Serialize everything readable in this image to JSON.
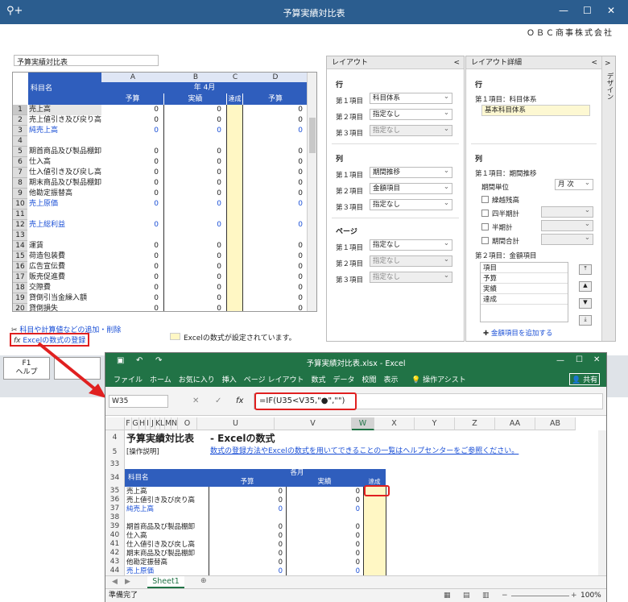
{
  "window": {
    "title": "予算実績対比表",
    "company": "ＯＢＣ商事株式会社",
    "minimize": "—",
    "maximize": "☐",
    "close": "✕"
  },
  "report_name": "予算実績対比表",
  "grid": {
    "col_letters": [
      "A",
      "B",
      "C",
      "D"
    ],
    "period": "年 4月",
    "item_header": "科目名",
    "sub_headers": [
      "予算",
      "実績",
      "達成",
      "予算"
    ],
    "rows": [
      {
        "n": "1",
        "name": "売上高",
        "a": "0",
        "b": "0",
        "d": "0",
        "blue": false
      },
      {
        "n": "2",
        "name": "売上値引き及び戻り高",
        "a": "0",
        "b": "0",
        "d": "0",
        "blue": false
      },
      {
        "n": "3",
        "name": "純売上高",
        "a": "0",
        "b": "0",
        "d": "0",
        "blue": true
      },
      {
        "n": "4",
        "name": "",
        "a": "",
        "b": "",
        "d": "",
        "blue": false
      },
      {
        "n": "5",
        "name": "期首商品及び製品棚卸",
        "a": "0",
        "b": "0",
        "d": "0",
        "blue": false
      },
      {
        "n": "6",
        "name": "仕入高",
        "a": "0",
        "b": "0",
        "d": "0",
        "blue": false
      },
      {
        "n": "7",
        "name": "仕入値引き及び戻し高",
        "a": "0",
        "b": "0",
        "d": "0",
        "blue": false
      },
      {
        "n": "8",
        "name": "期末商品及び製品棚卸",
        "a": "0",
        "b": "0",
        "d": "0",
        "blue": false
      },
      {
        "n": "9",
        "name": "他勘定振替高",
        "a": "0",
        "b": "0",
        "d": "0",
        "blue": false
      },
      {
        "n": "10",
        "name": "売上原価",
        "a": "0",
        "b": "0",
        "d": "0",
        "blue": true
      },
      {
        "n": "11",
        "name": "",
        "a": "",
        "b": "",
        "d": "",
        "blue": false
      },
      {
        "n": "12",
        "name": "売上総利益",
        "a": "0",
        "b": "0",
        "d": "0",
        "blue": true
      },
      {
        "n": "13",
        "name": "",
        "a": "",
        "b": "",
        "d": "",
        "blue": false
      },
      {
        "n": "14",
        "name": "運賃",
        "a": "0",
        "b": "0",
        "d": "0",
        "blue": false
      },
      {
        "n": "15",
        "name": "荷造包装費",
        "a": "0",
        "b": "0",
        "d": "0",
        "blue": false
      },
      {
        "n": "16",
        "name": "広告宣伝費",
        "a": "0",
        "b": "0",
        "d": "0",
        "blue": false
      },
      {
        "n": "17",
        "name": "販売促進費",
        "a": "0",
        "b": "0",
        "d": "0",
        "blue": false
      },
      {
        "n": "18",
        "name": "交際費",
        "a": "0",
        "b": "0",
        "d": "0",
        "blue": false
      },
      {
        "n": "19",
        "name": "貸倒引当金繰入額",
        "a": "0",
        "b": "0",
        "d": "0",
        "blue": false
      },
      {
        "n": "20",
        "name": "貸倒損失",
        "a": "0",
        "b": "0",
        "d": "0",
        "blue": false
      }
    ]
  },
  "links": {
    "add_items": "科目や計算値などの追加・削除",
    "register_excel": "Excelの数式の登録",
    "legend": "Excelの数式が設定されています。"
  },
  "layout": {
    "title": "レイアウト",
    "row_section": "行",
    "col_section": "列",
    "page_section": "ページ",
    "item1": "第１項目",
    "item2": "第２項目",
    "item3": "第３項目",
    "row_values": [
      "科目体系",
      "指定なし",
      "指定なし"
    ],
    "col_values": [
      "期間推移",
      "金額項目",
      "指定なし"
    ],
    "page_values": [
      "指定なし",
      "指定なし",
      "指定なし"
    ]
  },
  "detail": {
    "title": "レイアウト詳細",
    "design_tab": "デザイン",
    "row_section": "行",
    "row_item": "第１項目：科目体系",
    "row_value": "基本科目体系",
    "col_section": "列",
    "col_item": "第１項目：期間推移",
    "period_unit": "期間単位",
    "period_unit_value": "月 次",
    "checks": [
      "繰越残高",
      "四半期計",
      "半期計",
      "期間合計"
    ],
    "item2": "第２項目：金額項目",
    "list_header": "項目",
    "list_items": [
      "予算",
      "実績",
      "達成"
    ],
    "add_amount": "金額項目を追加する"
  },
  "fbuttons": {
    "f1_key": "F1",
    "f1_label": "ヘルプ"
  },
  "excel": {
    "title": "予算実績対比表.xlsx - Excel",
    "menu": [
      "ファイル",
      "ホーム",
      "お気に入り",
      "挿入",
      "ページ レイアウト",
      "数式",
      "データ",
      "校閲",
      "表示"
    ],
    "tell_me": "操作アシスト",
    "share": "共有",
    "namebox": "W35",
    "formula": "=IF(U35<V35,\"●\",\"\")",
    "columns": [
      "F",
      "G",
      "H",
      "I",
      "J",
      "K",
      "L",
      "M",
      "N",
      "O",
      "U",
      "V",
      "W",
      "X",
      "Y",
      "Z",
      "AA",
      "AB"
    ],
    "row_numbers": [
      "4",
      "5",
      "33",
      "34",
      "35",
      "36",
      "37",
      "38",
      "39",
      "40",
      "41",
      "42",
      "43",
      "44"
    ],
    "heading": "予算実績対比表",
    "subheading": "- Excelの数式",
    "op_label": "[操作説明]",
    "help_link": "数式の登録方法やExcelの数式を用いてできることの一覧はヘルプセンターをご参照ください。",
    "period": "各月",
    "item_header": "科目名",
    "sub_headers": [
      "予算",
      "実績",
      "達成"
    ],
    "rows": [
      {
        "name": "売上高",
        "u": "0",
        "v": "0",
        "blue": false
      },
      {
        "name": "売上値引き及び戻り高",
        "u": "0",
        "v": "0",
        "blue": false
      },
      {
        "name": "純売上高",
        "u": "0",
        "v": "0",
        "blue": true
      },
      {
        "name": "",
        "u": "",
        "v": "",
        "blue": false
      },
      {
        "name": "期首商品及び製品棚卸",
        "u": "0",
        "v": "0",
        "blue": false
      },
      {
        "name": "仕入高",
        "u": "0",
        "v": "0",
        "blue": false
      },
      {
        "name": "仕入値引き及び戻し高",
        "u": "0",
        "v": "0",
        "blue": false
      },
      {
        "name": "期末商品及び製品棚卸",
        "u": "0",
        "v": "0",
        "blue": false
      },
      {
        "name": "他勘定振替高",
        "u": "0",
        "v": "0",
        "blue": false
      },
      {
        "name": "売上原価",
        "u": "0",
        "v": "0",
        "blue": true
      }
    ],
    "sheet_tab": "Sheet1",
    "status": "準備完了",
    "zoom": "100%"
  }
}
